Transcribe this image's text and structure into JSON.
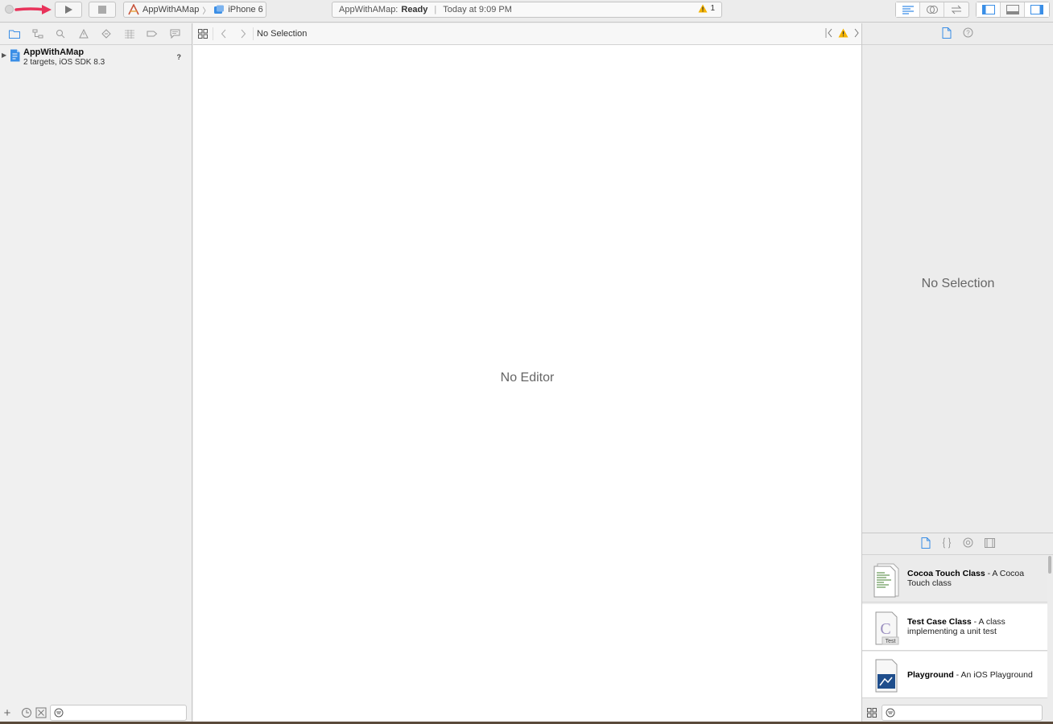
{
  "toolbar": {
    "scheme_target": "AppWithAMap",
    "scheme_device": "iPhone 6",
    "activity_app": "AppWithAMap:",
    "activity_status": "Ready",
    "activity_separator": "|",
    "activity_time": "Today at 9:09 PM",
    "warning_count": "1",
    "annotation_arrow_color": "#e8325a"
  },
  "navigator": {
    "project_name": "AppWithAMap",
    "project_subtitle": "2 targets, iOS SDK 8.3",
    "project_status": "?"
  },
  "editor": {
    "jump_title": "No Selection",
    "placeholder": "No Editor"
  },
  "inspector": {
    "placeholder": "No Selection"
  },
  "library": {
    "items": [
      {
        "title": "Cocoa Touch Class",
        "desc": " - A Cocoa Touch class"
      },
      {
        "title": "Test Case Class",
        "desc": " - A class implementing a unit test"
      },
      {
        "title": "Playground",
        "desc": " - An iOS Playground"
      }
    ]
  },
  "colors": {
    "accent": "#3a8ee6",
    "warning": "#f5b400"
  }
}
